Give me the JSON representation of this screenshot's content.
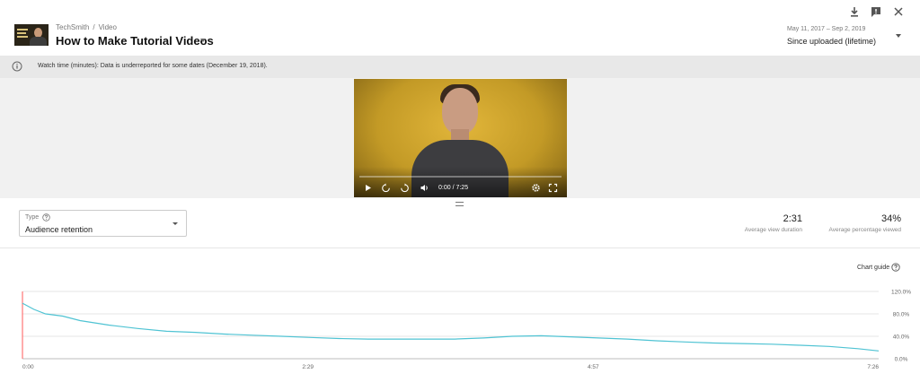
{
  "header": {
    "breadcrumb": [
      "TechSmith",
      "/",
      "Video"
    ],
    "title": "How to Make Tutorial Videos",
    "date_range": "May 11, 2017 – Sep 2, 2019",
    "range_label": "Since uploaded (lifetime)"
  },
  "notice": {
    "text": "Watch time (minutes): Data is underreported for some dates (December 19, 2018)."
  },
  "player": {
    "time": "0:00 / 7:25",
    "progress": 0
  },
  "controls": {
    "type_label": "Type",
    "type_value": "Audience retention"
  },
  "metrics": [
    {
      "value": "2:31",
      "label": "Average view duration"
    },
    {
      "value": "34%",
      "label": "Average percentage viewed"
    }
  ],
  "chart_guide": "Chart guide",
  "colors": {
    "line": "#4fc3d3",
    "marker": "#ff5a5a",
    "grid": "#e6e6e6"
  },
  "chart_data": {
    "type": "line",
    "x_ticks": [
      "0:00",
      "2:29",
      "4:57",
      "7:26"
    ],
    "y_ticks": [
      "120.0%",
      "80.0%",
      "40.0%",
      "0.0%"
    ],
    "ylim": [
      0,
      120
    ],
    "x": [
      0,
      0.1,
      0.2,
      0.35,
      0.5,
      0.75,
      1,
      1.25,
      1.5,
      1.75,
      2,
      2.25,
      2.5,
      2.75,
      3,
      3.25,
      3.5,
      3.75,
      4,
      4.25,
      4.5,
      4.75,
      5,
      5.25,
      5.5,
      5.75,
      6,
      6.25,
      6.5,
      6.75,
      7,
      7.25,
      7.43
    ],
    "series": [
      {
        "values": [
          99,
          88,
          80,
          76,
          68,
          60,
          54,
          49,
          47,
          44,
          42,
          40,
          38,
          36,
          35,
          35,
          35,
          35,
          37,
          40,
          41,
          39,
          37,
          35,
          32,
          30,
          28,
          27,
          26,
          24,
          22,
          18,
          14
        ]
      }
    ]
  }
}
